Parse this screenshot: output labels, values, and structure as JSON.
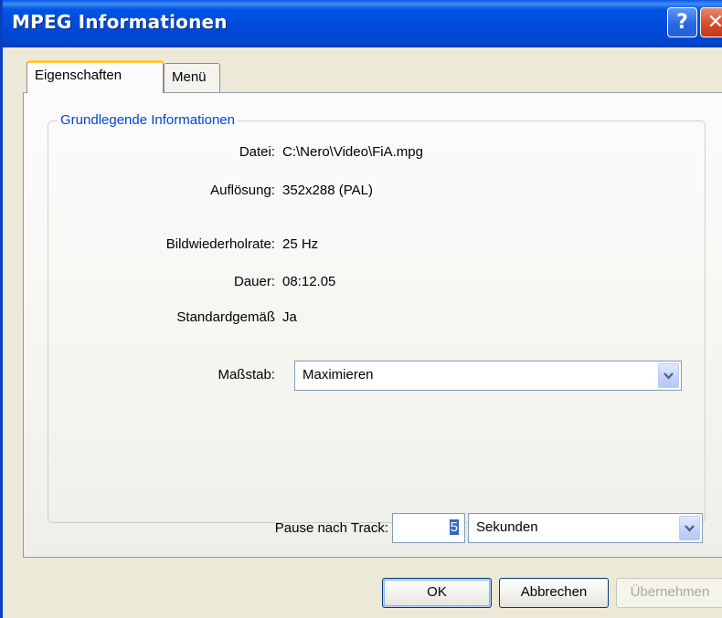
{
  "window": {
    "title": "MPEG Informationen"
  },
  "titlebar": {
    "help_label": "?",
    "close_label": "✕"
  },
  "tabs": [
    {
      "label": "Eigenschaften",
      "active": true
    },
    {
      "label": "Menü",
      "active": false
    }
  ],
  "group": {
    "title": "Grundlegende Informationen"
  },
  "info": {
    "file_label": "Datei:",
    "file_value": "C:\\Nero\\Video\\FiA.mpg",
    "resolution_label": "Auflösung:",
    "resolution_value": "352x288 (PAL)",
    "framerate_label": "Bildwiederholrate:",
    "framerate_value": "25 Hz",
    "duration_label": "Dauer:",
    "duration_value": "08:12.05",
    "compliant_label": "Standardgemäß",
    "compliant_value": "Ja"
  },
  "scale": {
    "label": "Maßstab:",
    "value": "Maximieren"
  },
  "pause": {
    "label": "Pause nach Track:",
    "value": "5",
    "unit": "Sekunden"
  },
  "buttons": {
    "ok": "OK",
    "cancel": "Abbrechen",
    "apply": "Übernehmen"
  },
  "colors": {
    "titlebar": "#0054e3",
    "legend_text": "#0046d5",
    "tab_highlight": "#ffc83c"
  },
  "icons": {
    "dropdown": "chevron-down-icon"
  }
}
